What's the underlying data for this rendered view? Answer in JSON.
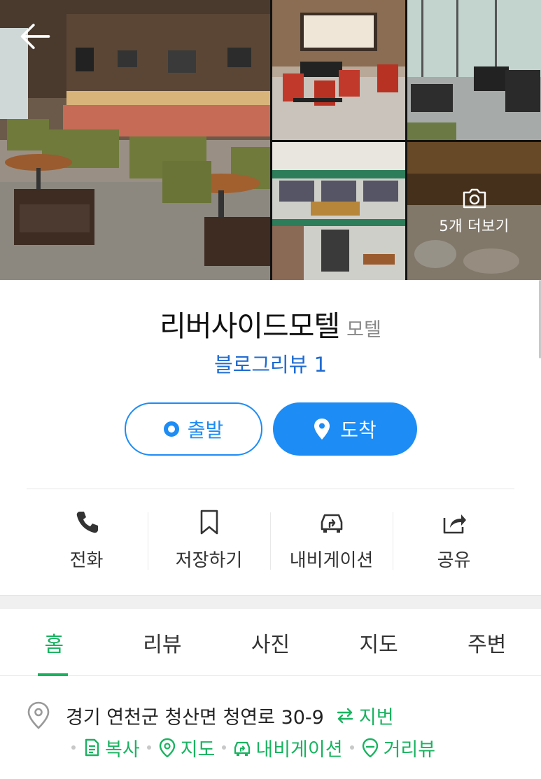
{
  "gallery": {
    "more_label": "5개 더보기",
    "icons": {
      "back": "arrow-left-icon",
      "camera": "camera-icon"
    }
  },
  "place": {
    "name": "리버사이드모텔",
    "category": "모텔",
    "blog_review": "블로그리뷰 1"
  },
  "route": {
    "depart_label": "출발",
    "arrive_label": "도착",
    "accent_color": "#1d8cf5"
  },
  "actions": [
    {
      "label": "전화",
      "icon": "phone-icon"
    },
    {
      "label": "저장하기",
      "icon": "bookmark-icon"
    },
    {
      "label": "내비게이션",
      "icon": "navigation-car-icon"
    },
    {
      "label": "공유",
      "icon": "share-icon"
    }
  ],
  "tabs": [
    {
      "label": "홈",
      "active": true
    },
    {
      "label": "리뷰",
      "active": false
    },
    {
      "label": "사진",
      "active": false
    },
    {
      "label": "지도",
      "active": false
    },
    {
      "label": "주변",
      "active": false
    }
  ],
  "address": {
    "text": "경기 연천군 청산면 청연로 30-9",
    "jibun_label": "지번",
    "links": [
      {
        "label": "복사",
        "icon": "copy-icon"
      },
      {
        "label": "지도",
        "icon": "map-pin-icon"
      },
      {
        "label": "내비게이션",
        "icon": "navigation-car-icon"
      },
      {
        "label": "거리뷰",
        "icon": "streetview-icon"
      }
    ]
  },
  "colors": {
    "green_accent": "#19b360",
    "blue_link": "#1e6bd1"
  }
}
